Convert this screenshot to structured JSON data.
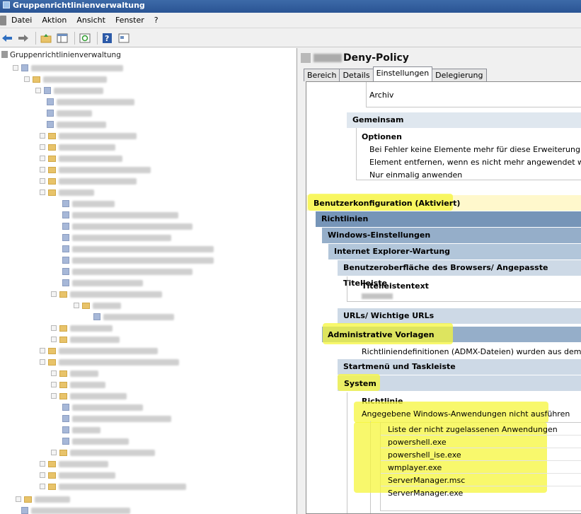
{
  "window": {
    "title": "Gruppenrichtlinienverwaltung"
  },
  "menu": {
    "items": [
      "Datei",
      "Aktion",
      "Ansicht",
      "Fenster",
      "?"
    ]
  },
  "toolbar": {
    "icons": [
      "back-arrow-icon",
      "forward-arrow-icon",
      "up-folder-icon",
      "show-hide-tree-icon",
      "refresh-icon",
      "help-icon",
      "properties-icon"
    ]
  },
  "tree": {
    "root_label": "Gruppenrichtlinienverwaltung"
  },
  "gpo": {
    "title": "Deny-Policy",
    "tabs": [
      "Bereich",
      "Details",
      "Einstellungen",
      "Delegierung"
    ],
    "active_tab": "Einstellungen"
  },
  "report": {
    "top_item": "Archiv",
    "gemeinsam": "Gemeinsam",
    "optionen": "Optionen",
    "option_lines": [
      "Bei Fehler keine Elemente mehr für diese Erweiterung verarbeit",
      "Element entfernen, wenn es nicht mehr angewendet wird",
      "Nur einmalig anwenden"
    ],
    "benutzerkonfiguration": "Benutzerkonfiguration (Aktiviert)",
    "richtlinien": "Richtlinien",
    "windows_einstellungen": "Windows-Einstellungen",
    "ie_wartung": "Internet Explorer-Wartung",
    "browser_ui": "Benutzeroberfläche des Browsers/ Angepasste Titelleiste",
    "titelleistentext": "Titelleistentext",
    "urls": "URLs/ Wichtige URLs",
    "admin_vorlagen": "Administrative Vorlagen",
    "admx_text": "Richtliniendefinitionen (ADMX-Dateien) wurden aus dem lokalen C",
    "startmenu": "Startmenü und Taskleiste",
    "system": "System",
    "richtlinie": "Richtlinie",
    "policy_name": "Angegebene Windows-Anwendungen nicht ausführen",
    "list_header": "Liste der nicht zugelassenen Anwendungen",
    "apps": [
      "powershell.exe",
      "powershell_ise.exe",
      "wmplayer.exe",
      "ServerManager.msc",
      "ServerManager.exe"
    ]
  },
  "colors": {
    "highlight": "#f5f53b",
    "title_bar": "#2a5494",
    "header_dark": "#7695b8"
  }
}
